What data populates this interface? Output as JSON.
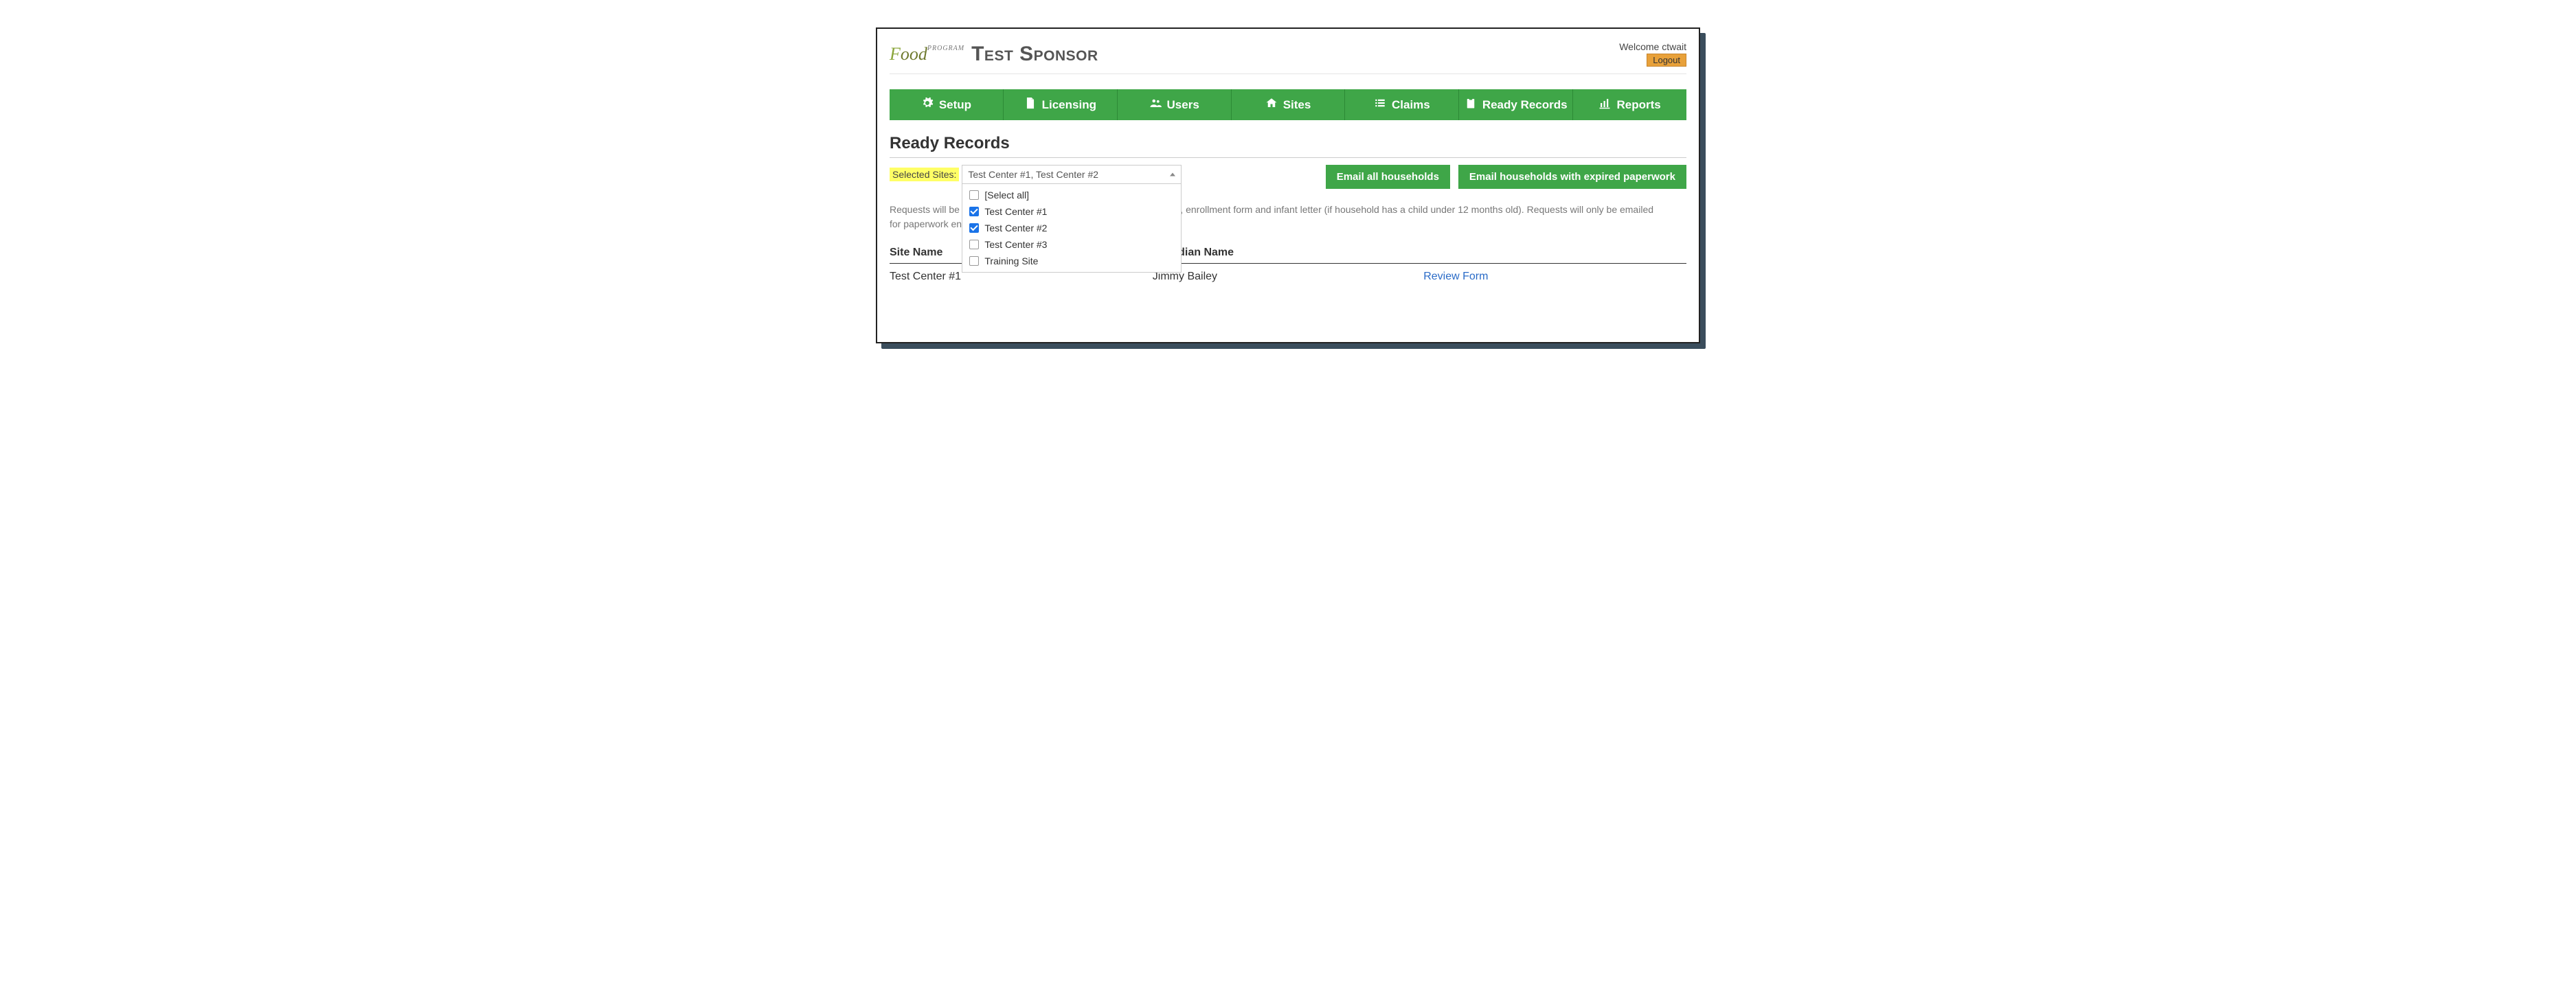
{
  "header": {
    "logo_text": "Food",
    "logo_sub": "PROGRAM",
    "sponsor_title": "Test Sponsor",
    "welcome_text": "Welcome ctwait",
    "logout_label": "Logout"
  },
  "nav": {
    "items": [
      {
        "label": "Setup",
        "icon": "gears-icon"
      },
      {
        "label": "Licensing",
        "icon": "file-icon"
      },
      {
        "label": "Users",
        "icon": "users-icon"
      },
      {
        "label": "Sites",
        "icon": "home-icon"
      },
      {
        "label": "Claims",
        "icon": "list-icon"
      },
      {
        "label": "Ready Records",
        "icon": "clipboard-icon"
      },
      {
        "label": "Reports",
        "icon": "barchart-icon"
      }
    ]
  },
  "page": {
    "title": "Ready Records",
    "selected_sites_label": "Selected Sites:",
    "info_text": "Requests will be emailed to the primary guardian for an income form, enrollment form and infant letter (if household has a child under 12 months old). Requests will only be emailed for paperwork enabled in My Food Program."
  },
  "multiselect": {
    "display_value": "Test Center #1, Test Center #2",
    "options": [
      {
        "label": "[Select all]",
        "checked": false
      },
      {
        "label": "Test Center #1",
        "checked": true
      },
      {
        "label": "Test Center #2",
        "checked": true
      },
      {
        "label": "Test Center #3",
        "checked": false
      },
      {
        "label": "Training Site",
        "checked": false
      }
    ]
  },
  "buttons": {
    "email_all": "Email all households",
    "email_expired": "Email households with expired paperwork"
  },
  "table": {
    "headers": {
      "site": "Site Name",
      "guardian": "Guardian Name",
      "action": ""
    },
    "rows": [
      {
        "site": "Test Center #1",
        "guardian": "Jimmy Bailey",
        "action": "Review Form"
      }
    ]
  }
}
